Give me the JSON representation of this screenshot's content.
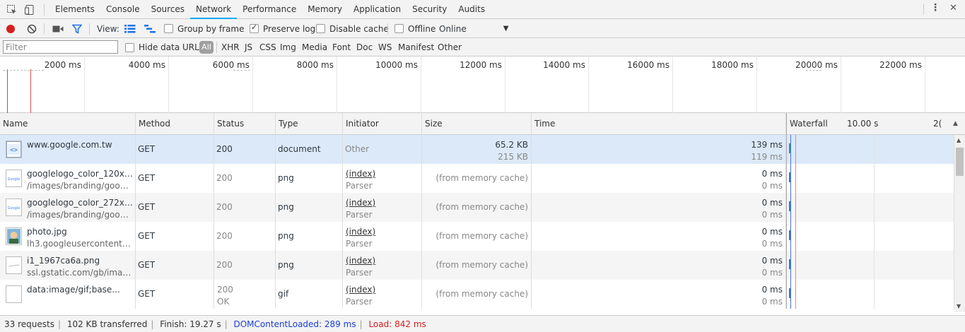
{
  "tabs": [
    {
      "label": "Elements"
    },
    {
      "label": "Console"
    },
    {
      "label": "Sources"
    },
    {
      "label": "Network"
    },
    {
      "label": "Performance"
    },
    {
      "label": "Memory"
    },
    {
      "label": "Application"
    },
    {
      "label": "Security"
    },
    {
      "label": "Audits"
    }
  ],
  "active_tab": "Network",
  "toolbar": {
    "view_label": "View:",
    "group_by_frame": {
      "label": "Group by frame",
      "checked": false
    },
    "preserve_log": {
      "label": "Preserve log",
      "checked": true
    },
    "disable_cache": {
      "label": "Disable cache",
      "checked": false
    },
    "offline": {
      "label": "Offline",
      "checked": false
    },
    "throttling": "Online"
  },
  "filter": {
    "placeholder": "Filter",
    "hide_data_urls": {
      "label": "Hide data URLs",
      "checked": false
    },
    "all_label": "All",
    "types": [
      "XHR",
      "JS",
      "CSS",
      "Img",
      "Media",
      "Font",
      "Doc",
      "WS",
      "Manifest",
      "Other"
    ]
  },
  "overview": {
    "ticks": [
      "2000 ms",
      "4000 ms",
      "6000 ms",
      "8000 ms",
      "10000 ms",
      "12000 ms",
      "14000 ms",
      "16000 ms",
      "18000 ms",
      "20000 ms",
      "22000 ms"
    ]
  },
  "columns": {
    "name": "Name",
    "method": "Method",
    "status": "Status",
    "type": "Type",
    "initiator": "Initiator",
    "size": "Size",
    "time": "Time",
    "waterfall": "Waterfall",
    "waterfall_tick1": "10.00 s",
    "waterfall_tick2": "2("
  },
  "requests": [
    {
      "name": "www.google.com.tw",
      "path": "",
      "method": "GET",
      "status": "200",
      "status_text": "",
      "type": "document",
      "initiator": "Other",
      "initiator_sub": "",
      "size": "65.2 KB",
      "size_sub": "215 KB",
      "time": "139 ms",
      "time_sub": "119 ms",
      "icon": "document-icon"
    },
    {
      "name": "googlelogo_color_120x44...",
      "path": "/images/branding/google...",
      "method": "GET",
      "status": "200",
      "status_text": "",
      "type": "png",
      "initiator": "(index)",
      "initiator_sub": "Parser",
      "size": "(from memory cache)",
      "size_sub": "",
      "time": "0 ms",
      "time_sub": "0 ms",
      "icon": "google-logo-thumb"
    },
    {
      "name": "googlelogo_color_272x92...",
      "path": "/images/branding/google...",
      "method": "GET",
      "status": "200",
      "status_text": "",
      "type": "png",
      "initiator": "(index)",
      "initiator_sub": "Parser",
      "size": "(from memory cache)",
      "size_sub": "",
      "time": "0 ms",
      "time_sub": "0 ms",
      "icon": "google-logo-thumb"
    },
    {
      "name": "photo.jpg",
      "path": "lh3.googleusercontent.co...",
      "method": "GET",
      "status": "200",
      "status_text": "",
      "type": "png",
      "initiator": "(index)",
      "initiator_sub": "Parser",
      "size": "(from memory cache)",
      "size_sub": "",
      "time": "0 ms",
      "time_sub": "0 ms",
      "icon": "photo-thumb"
    },
    {
      "name": "i1_1967ca6a.png",
      "path": "ssl.gstatic.com/gb/images",
      "method": "GET",
      "status": "200",
      "status_text": "",
      "type": "png",
      "initiator": "(index)",
      "initiator_sub": "Parser",
      "size": "(from memory cache)",
      "size_sub": "",
      "time": "0 ms",
      "time_sub": "0 ms",
      "icon": "image-thumb"
    },
    {
      "name": "data:image/gif;base...",
      "path": "",
      "method": "GET",
      "status": "200",
      "status_text": "OK",
      "type": "gif",
      "initiator": "(index)",
      "initiator_sub": "Parser",
      "size": "(from memory cache)",
      "size_sub": "",
      "time": "0 ms",
      "time_sub": "0 ms",
      "icon": "blank-thumb"
    }
  ],
  "status_bar": {
    "requests": "33 requests",
    "transferred": "102 KB transferred",
    "finish": "Finish: 19.27 s",
    "dom_content_loaded": "DOMContentLoaded: 289 ms",
    "load": "Load: 842 ms"
  },
  "colors": {
    "accent": "#03a9f4",
    "record": "#d61e1e",
    "dcl_blue": "#1a3fd6",
    "load_red": "#d61e1e",
    "selected_row": "#dce9f8"
  }
}
